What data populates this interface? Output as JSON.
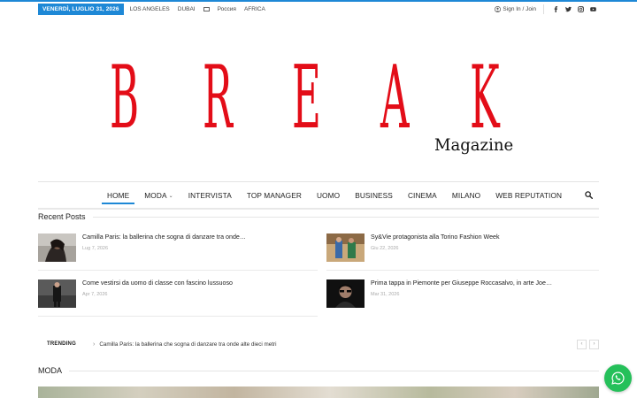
{
  "topbar": {
    "date": "VENERDÌ, LUGLIO 31, 2026",
    "links": [
      "LOS ANGELES",
      "DUBAI",
      "",
      "Россия",
      "AFRICA"
    ],
    "signin": "Sign In / Join",
    "social_icons": [
      "facebook-icon",
      "twitter-icon",
      "instagram-icon",
      "youtube-icon"
    ]
  },
  "logo": {
    "letters": [
      "B",
      "R",
      "E",
      "A",
      "K"
    ],
    "sub": "Magazine",
    "color": "#e30d18"
  },
  "nav": {
    "items": [
      "HOME",
      "MODA",
      "INTERVISTA",
      "TOP MANAGER",
      "UOMO",
      "BUSINESS",
      "CINEMA",
      "MILANO",
      "WEB REPUTATION"
    ],
    "active": "HOME",
    "accent": "#1e88d6"
  },
  "recent": {
    "title": "Recent Posts",
    "posts": [
      {
        "title": "Camilla Paris: la ballerina che sogna di danzare tra onde…",
        "date": "Lug 7, 2026"
      },
      {
        "title": "Sy&Vie protagonista alla Torino Fashion Week",
        "date": "Giu 22, 2026"
      },
      {
        "title": "Come vestirsi da uomo di classe con fascino lussuoso",
        "date": "Apr 7, 2026"
      },
      {
        "title": "Prima tappa in Piemonte per Giuseppe Roccasalvo, in arte Joe…",
        "date": "Mar 31, 2026"
      }
    ]
  },
  "trending": {
    "label": "TRENDING",
    "text": "Camilla Paris: la ballerina che sogna di danzare tra onde alte dieci metri",
    "prev": "‹",
    "next": "›"
  },
  "moda": {
    "title": "MODA"
  },
  "whatsapp": {
    "color": "#25c05a"
  }
}
